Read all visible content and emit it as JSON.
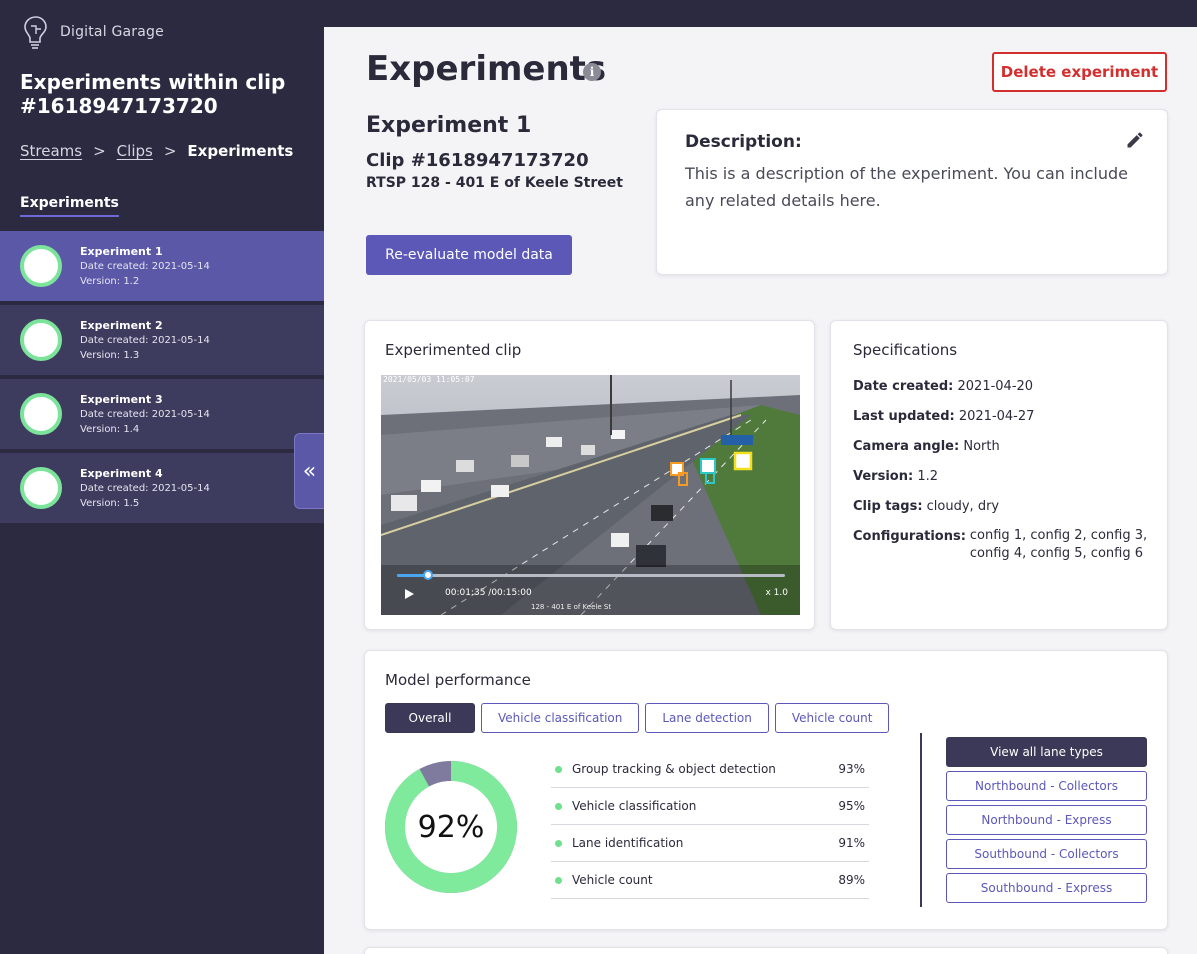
{
  "brand": {
    "name": "Digital Garage"
  },
  "sidebar": {
    "title": "Experiments within clip #1618947173720",
    "breadcrumb": {
      "streams": "Streams",
      "sep1": ">",
      "clips": "Clips",
      "sep2": ">",
      "current": "Experiments"
    },
    "section_label": "Experiments",
    "items": [
      {
        "name": "Experiment 1",
        "date": "Date created: 2021-05-14",
        "version": "Version: 1.2"
      },
      {
        "name": "Experiment 2",
        "date": "Date created: 2021-05-14",
        "version": "Version: 1.3"
      },
      {
        "name": "Experiment 3",
        "date": "Date created: 2021-05-14",
        "version": "Version: 1.4"
      },
      {
        "name": "Experiment 4",
        "date": "Date created: 2021-05-14",
        "version": "Version: 1.5"
      }
    ],
    "collapse_glyph": "«"
  },
  "header": {
    "title": "Experiments",
    "info_glyph": "i",
    "delete_label": "Delete experiment"
  },
  "experiment": {
    "name": "Experiment 1",
    "clip": "Clip #1618947173720",
    "stream": "RTSP 128 - 401 E of Keele Street",
    "reevaluate_label": "Re-evaluate model data"
  },
  "description": {
    "label": "Description:",
    "text": "This is a description of the experiment. You can include any related details here."
  },
  "clip_card": {
    "title": "Experimented clip",
    "overlay_stamp": "2021/05/03  11:05:07",
    "time": "00:01:35 /00:15:00",
    "speed": "x 1.0",
    "caption": "128 - 401 E of Keele St",
    "progress": 0.08
  },
  "specs": {
    "title": "Specifications",
    "rows": [
      {
        "label": "Date created:",
        "value": "2021-04-20"
      },
      {
        "label": "Last updated:",
        "value": "2021-04-27"
      },
      {
        "label": "Camera angle:",
        "value": "North"
      },
      {
        "label": "Version:",
        "value": "1.2"
      },
      {
        "label": "Clip tags:",
        "value": "cloudy,  dry"
      }
    ],
    "config_label": "Configurations:",
    "config_line1": "config 1, config 2, config 3,",
    "config_line2": "config 4, config 5, config 6"
  },
  "performance": {
    "title": "Model performance",
    "tabs": [
      "Overall",
      "Vehicle classification",
      "Lane detection",
      "Vehicle count"
    ],
    "overall": "92%",
    "overall_value": 0.92,
    "metrics": [
      {
        "label": "Group tracking & object detection",
        "value": "93%"
      },
      {
        "label": "Vehicle classification",
        "value": "95%"
      },
      {
        "label": "Lane identification",
        "value": "91%"
      },
      {
        "label": "Vehicle count",
        "value": "89%"
      }
    ],
    "lanes": [
      "View all lane types",
      "Northbound - Collectors",
      "Northbound - Express",
      "Southbound - Collectors",
      "Southbound - Express"
    ]
  },
  "colors": {
    "accent": "#5b58b8",
    "sidebar": "#2b2a40",
    "danger": "#d32f2f",
    "success": "#7be49a"
  }
}
